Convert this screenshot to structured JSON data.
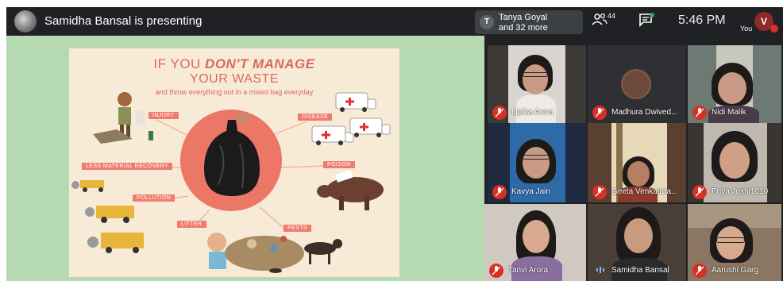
{
  "topbar": {
    "presenter_title": "Samidha Bansal is presenting",
    "presentation_chip": {
      "badge": "T",
      "line1": "Tanya Goyal",
      "line2": "and 32 more"
    },
    "people_count": "44",
    "clock": "5:46  PM",
    "you_label": "You",
    "you_initial": "V"
  },
  "slide": {
    "title_pre": "IF YOU ",
    "title_emph": "DON'T MANAGE",
    "title_line2": "YOUR WASTE",
    "subtitle": "and throw everything out in a mixed bag everyday",
    "tags": {
      "injury": "INJURY",
      "disease": "DISEASE",
      "less_recovery": "LESS MATERIAL RECOVERY",
      "poison": "POISON",
      "pollution": "POLLUTION",
      "litter": "LITTER",
      "pests": "PESTS"
    }
  },
  "participants": [
    {
      "name": "Lipika Arora",
      "muted": true
    },
    {
      "name": "Madhura Dwived...",
      "muted": true
    },
    {
      "name": "Nidi Malik",
      "muted": true
    },
    {
      "name": "Kavya Jain",
      "muted": true
    },
    {
      "name": "Geeta Venkatara...",
      "muted": true
    },
    {
      "name": "Priya Joshi1010",
      "muted": true
    },
    {
      "name": "Tanvi Arora",
      "muted": true
    },
    {
      "name": "Samidha Bansal",
      "muted": false
    },
    {
      "name": "Aarushi Garg",
      "muted": true
    }
  ],
  "colors": {
    "topbar_bg": "#202124",
    "stage_bg": "#b5d9b0",
    "slide_accent": "#ec7767",
    "muted_red": "#d93025"
  }
}
